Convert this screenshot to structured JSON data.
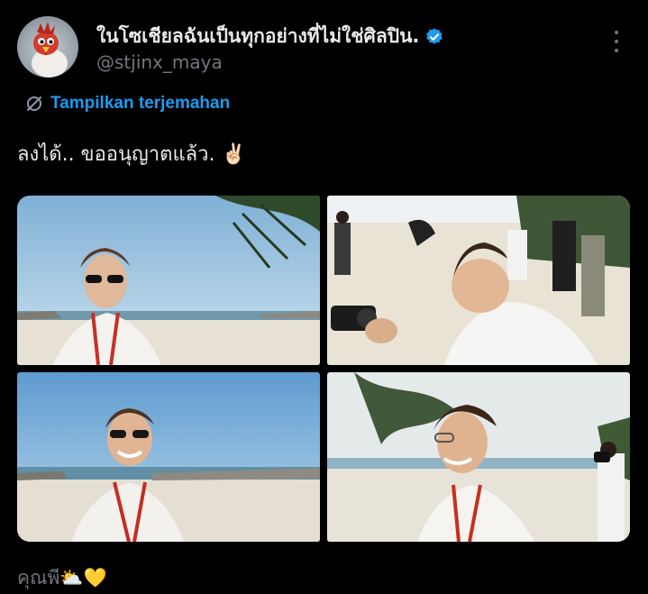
{
  "author": {
    "display_name": "ในโซเชียลฉันเป็นทุกอย่างที่ไม่ใช่ศิลปิน.",
    "handle": "@stjinx_maya",
    "verified": true,
    "avatar_icon": "chicken-mascot-avatar"
  },
  "menu": {
    "icon": "more-vertical-icon"
  },
  "translate": {
    "label": "Tampilkan terjemahan",
    "icon": "translate-icon",
    "color": "#1d9bf0"
  },
  "post": {
    "text": "ลงได้.. ขออนุญาตแล้ว. ✌🏻"
  },
  "media": [
    {
      "name": "photo-1"
    },
    {
      "name": "photo-2"
    },
    {
      "name": "photo-3"
    },
    {
      "name": "photo-4"
    }
  ],
  "quoted_text": "คุณพี⛅💛",
  "colors": {
    "background": "#000000",
    "text_primary": "#e7e9ea",
    "text_secondary": "#71767b",
    "verified_badge": "#1d9bf0"
  }
}
